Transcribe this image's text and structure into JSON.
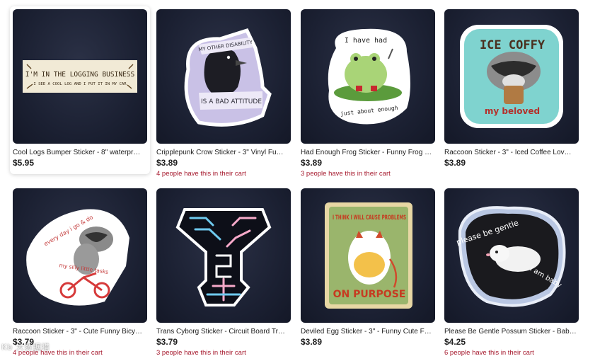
{
  "products": [
    {
      "title": "Cool Logs Bumper Sticker - 8\" waterpr…",
      "price": "$5.95",
      "cart": "",
      "art": {
        "line1": "I'M IN THE LOGGING BUSINESS",
        "line2": "I SEE A COOL LOG AND I PUT IT IN MY CAR"
      }
    },
    {
      "title": "Cripplepunk Crow Sticker - 3\" Vinyl Fu…",
      "price": "$3.89",
      "cart": "4 people have this in their cart",
      "art": {
        "line1": "MY OTHER DISABILITY",
        "line2": "IS A BAD ATTITUDE"
      }
    },
    {
      "title": "Had Enough Frog Sticker - Funny Frog …",
      "price": "$3.89",
      "cart": "3 people have this in their cart",
      "art": {
        "line1": "I have had",
        "line2": "just about enough"
      }
    },
    {
      "title": "Raccoon Sticker - 3\" - Iced Coffee Lov…",
      "price": "$3.89",
      "cart": "",
      "art": {
        "line1": "ICE COFFY",
        "line2": "my beloved"
      }
    },
    {
      "title": "Raccoon Sticker - 3\" - Cute Funny Bicy…",
      "price": "$3.79",
      "cart": "4 people have this in their cart",
      "art": {
        "line1": "every day i go & do",
        "line2": "my silly little tasks"
      }
    },
    {
      "title": "Trans Cyborg Sticker - Circuit Board Tr…",
      "price": "$3.79",
      "cart": "3 people have this in their cart",
      "art": {
        "line1": "",
        "line2": ""
      }
    },
    {
      "title": "Deviled Egg Sticker - 3\" - Funny Cute F…",
      "price": "$3.89",
      "cart": "",
      "art": {
        "line1": "I THINK I WILL CAUSE PROBLEMS",
        "line2": "ON PURPOSE"
      }
    },
    {
      "title": "Please Be Gentle Possum Sticker - Bab…",
      "price": "$4.25",
      "cart": "6 people have this in their cart",
      "art": {
        "line1": "please be gentle",
        "line2": "i am baby"
      }
    }
  ],
  "watermark": "Kb 大数据猎",
  "colors": {
    "cart_text": "#a61a2e",
    "thumb_bg": "#1b2032"
  }
}
